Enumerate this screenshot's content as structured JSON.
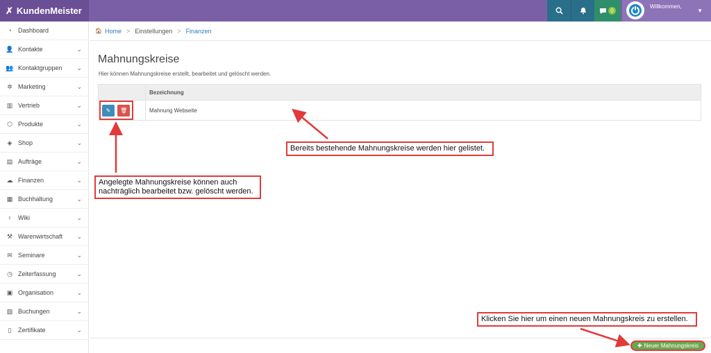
{
  "app": {
    "name": "KundenMeister",
    "logo_icon": "k-logo-icon"
  },
  "topbar": {
    "chat_badge": "0",
    "welcome": "Willkommen,"
  },
  "sidebar": {
    "items": [
      {
        "label": "Dashboard",
        "icon": "dashboard-icon",
        "glyph": "◔",
        "chevron": ""
      },
      {
        "label": "Kontakte",
        "icon": "contacts-icon",
        "glyph": "👤",
        "chevron": "⌄"
      },
      {
        "label": "Kontaktgruppen",
        "icon": "groups-icon",
        "glyph": "👥",
        "chevron": "⌄"
      },
      {
        "label": "Marketing",
        "icon": "marketing-icon",
        "glyph": "✲",
        "chevron": "⌄"
      },
      {
        "label": "Vertrieb",
        "icon": "sales-icon",
        "glyph": "▥",
        "chevron": "⌄"
      },
      {
        "label": "Produkte",
        "icon": "products-icon",
        "glyph": "⬡",
        "chevron": "⌄"
      },
      {
        "label": "Shop",
        "icon": "shop-icon",
        "glyph": "◈",
        "chevron": "⌄"
      },
      {
        "label": "Aufträge",
        "icon": "orders-icon",
        "glyph": "▤",
        "chevron": "⌄"
      },
      {
        "label": "Finanzen",
        "icon": "finance-icon",
        "glyph": "☁",
        "chevron": "⌄"
      },
      {
        "label": "Buchhaltung",
        "icon": "accounting-icon",
        "glyph": "▦",
        "chevron": "⌄"
      },
      {
        "label": "Wiki",
        "icon": "wiki-icon",
        "glyph": "♀",
        "chevron": "⌄"
      },
      {
        "label": "Warenwirtschaft",
        "icon": "inventory-icon",
        "glyph": "⚒",
        "chevron": "⌄"
      },
      {
        "label": "Seminare",
        "icon": "seminar-icon",
        "glyph": "✉",
        "chevron": "⌄"
      },
      {
        "label": "Zeiterfassung",
        "icon": "clock-icon",
        "glyph": "◷",
        "chevron": "⌄"
      },
      {
        "label": "Organisation",
        "icon": "organisation-icon",
        "glyph": "▣",
        "chevron": "⌄"
      },
      {
        "label": "Buchungen",
        "icon": "bookings-icon",
        "glyph": "▨",
        "chevron": "⌄"
      },
      {
        "label": "Zertifikate",
        "icon": "certificate-icon",
        "glyph": "▯",
        "chevron": "⌄"
      }
    ]
  },
  "breadcrumb": {
    "home": "Home",
    "level1": "Einstellungen",
    "current": "Finanzen",
    "sep": ">"
  },
  "main": {
    "title": "Mahnungskreise",
    "description": "Hier können Mahnungskreise erstellt, bearbeitet und gelöscht werden.",
    "table": {
      "header": "Bezeichnung",
      "rows": [
        {
          "name": "Mahnung Webseite"
        }
      ]
    },
    "new_button": "Neuer Mahnungskreis"
  },
  "annotations": {
    "listed": "Bereits bestehende Mahnungskreise werden hier gelistet.",
    "edit_delete": "Angelegte Mahnungskreise können auch nachträglich bearbeitet bzw. gelöscht werden.",
    "create": "Klicken Sie hier um einen neuen Mahnungskreis zu erstellen."
  },
  "colors": {
    "topbar": "#7a5fa6",
    "annotation": "#e03a3a",
    "edit": "#3c8dbc",
    "delete": "#d9534f",
    "new": "#6aa84f"
  }
}
